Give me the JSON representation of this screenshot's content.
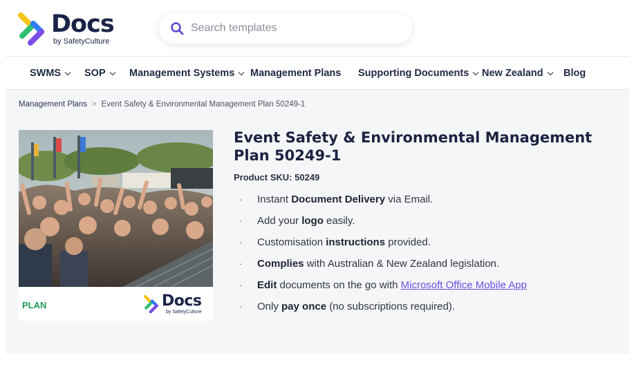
{
  "brand": {
    "name": "Docs",
    "tagline": "by SafetyCulture"
  },
  "search": {
    "placeholder": "Search templates",
    "value": ""
  },
  "nav": {
    "items": [
      {
        "label": "SWMS",
        "dropdown": true
      },
      {
        "label": "SOP",
        "dropdown": true
      },
      {
        "label": "Management Systems",
        "dropdown": true
      },
      {
        "label": "Management Plans",
        "dropdown": false
      },
      {
        "label": "Supporting Documents",
        "dropdown": true
      },
      {
        "label": "New Zealand",
        "dropdown": true
      },
      {
        "label": "Blog",
        "dropdown": false
      }
    ]
  },
  "breadcrumb": {
    "parent": "Management Plans",
    "separator": ">",
    "current": "Event Safety & Environmental Management Plan 50249-1"
  },
  "product": {
    "card_badge": "PLAN",
    "title": "Event Safety & Environmental Management Plan 50249-1",
    "sku_label": "Product SKU:",
    "sku_value": "50249",
    "features": [
      {
        "pre": "Instant ",
        "bold": "Document Delivery",
        "post": " via Email."
      },
      {
        "pre": "Add your ",
        "bold": "logo",
        "post": " easily."
      },
      {
        "pre": "Customisation ",
        "bold": "instructions",
        "post": " provided."
      },
      {
        "pre": "",
        "bold": "Complies",
        "post": " with Australian & New Zealand legislation."
      },
      {
        "pre": "",
        "bold": "Edit",
        "post": " documents on the go with ",
        "link": "Microsoft Office Mobile App"
      },
      {
        "pre": "Only ",
        "bold": "pay once",
        "post": " (no subscriptions required)."
      }
    ]
  },
  "colors": {
    "brand_navy": "#1a2447",
    "accent_purple": "#6a4fe0",
    "plan_green": "#1e9a52",
    "logo_yellow": "#f5c518",
    "logo_green": "#2fbf71",
    "logo_blue": "#2f7cf6",
    "logo_purple": "#7b4de8"
  },
  "icons": {
    "search": "search-icon",
    "chevron": "chevron-down-icon",
    "bullet": "·"
  }
}
